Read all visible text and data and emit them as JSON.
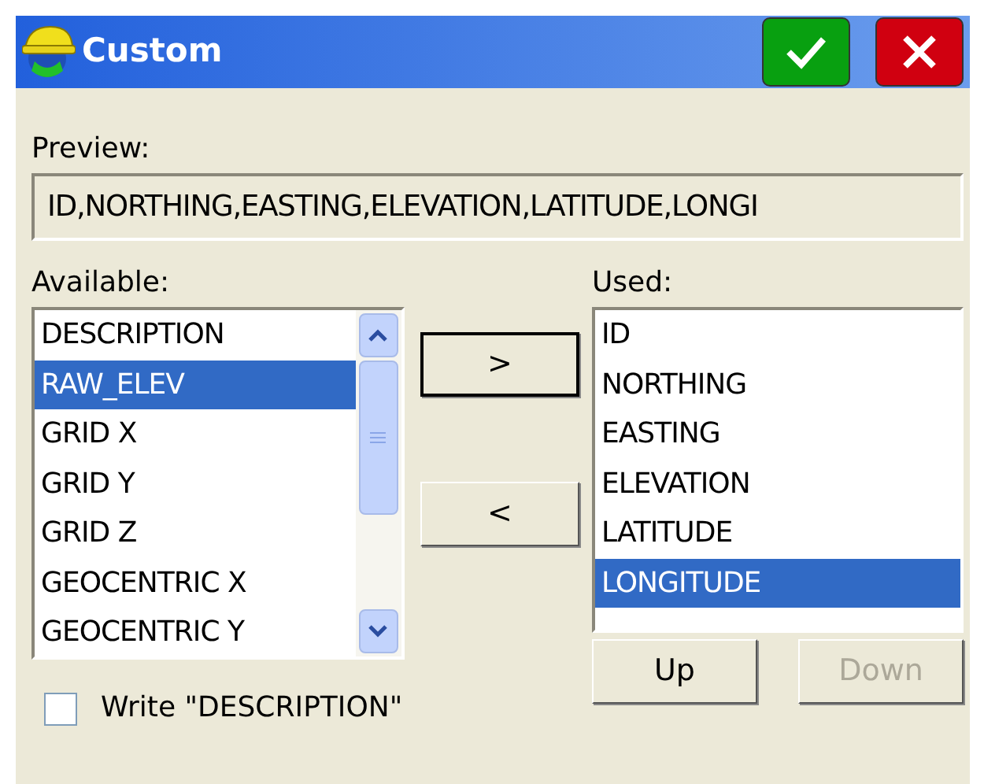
{
  "window": {
    "title": "Custom"
  },
  "preview": {
    "label": "Preview:",
    "value": "ID,NORTHING,EASTING,ELEVATION,LATITUDE,LONGI"
  },
  "available": {
    "label": "Available:",
    "items": [
      {
        "text": "DESCRIPTION",
        "selected": false
      },
      {
        "text": "RAW_ELEV",
        "selected": true
      },
      {
        "text": "GRID X",
        "selected": false
      },
      {
        "text": "GRID Y",
        "selected": false
      },
      {
        "text": "GRID Z",
        "selected": false
      },
      {
        "text": "GEOCENTRIC X",
        "selected": false
      },
      {
        "text": "GEOCENTRIC Y",
        "selected": false
      }
    ]
  },
  "move_buttons": [
    {
      "label": ">",
      "kind": "add"
    },
    {
      "label": "<",
      "kind": "remove"
    }
  ],
  "used": {
    "label": "Used:",
    "items": [
      {
        "text": "ID",
        "selected": false
      },
      {
        "text": "NORTHING",
        "selected": false
      },
      {
        "text": "EASTING",
        "selected": false
      },
      {
        "text": "ELEVATION",
        "selected": false
      },
      {
        "text": "LATITUDE",
        "selected": false
      },
      {
        "text": "LONGITUDE",
        "selected": true
      }
    ]
  },
  "order_buttons": [
    {
      "label": "Up",
      "disabled": false
    },
    {
      "label": "Down",
      "disabled": true
    }
  ],
  "write_option": {
    "label": "Write \"DESCRIPTION\"",
    "checked": false
  }
}
